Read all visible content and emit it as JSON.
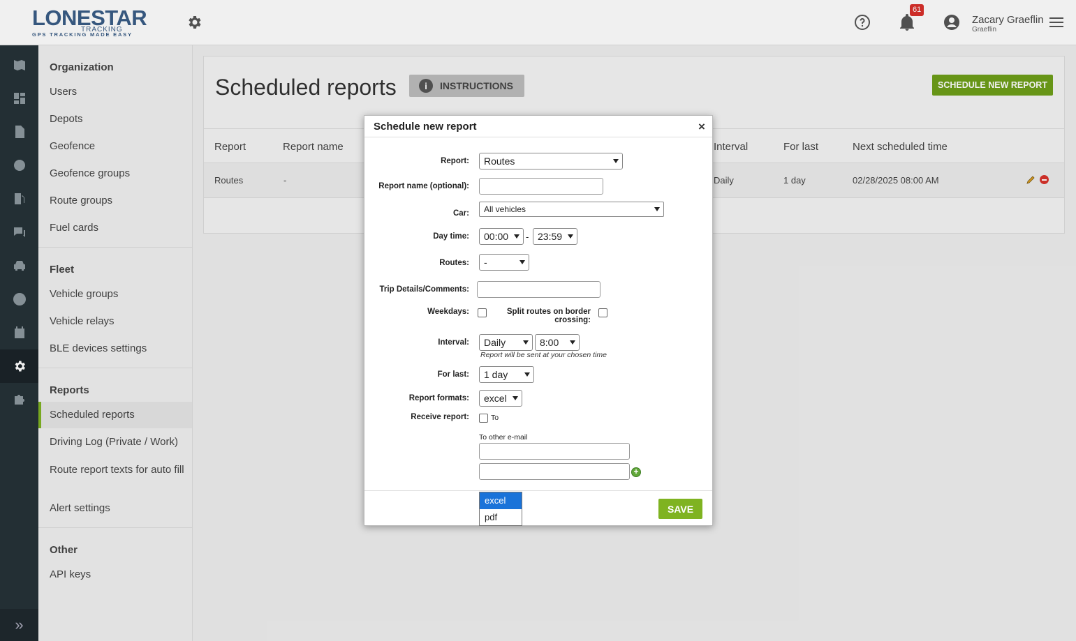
{
  "header": {
    "logo_main": "LONESTAR",
    "logo_sub": "TRACKING",
    "logo_tagline": "GPS TRACKING MADE EASY",
    "notification_count": "61",
    "user_name": "Zacary Graeflin",
    "user_org": "Graeflin"
  },
  "sidebar": {
    "sections": [
      {
        "title": "Organization",
        "items": [
          "Users",
          "Depots",
          "Geofence",
          "Geofence groups",
          "Route groups",
          "Fuel cards"
        ]
      },
      {
        "title": "Fleet",
        "items": [
          "Vehicle groups",
          "Vehicle relays",
          "BLE devices settings"
        ]
      },
      {
        "title": "Reports",
        "items": [
          "Scheduled reports",
          "Driving Log (Private / Work)",
          "Route report texts for auto fill",
          "Alert settings"
        ]
      },
      {
        "title": "Other",
        "items": [
          "API keys"
        ]
      }
    ],
    "active_item": "Scheduled reports"
  },
  "main": {
    "title": "Scheduled reports",
    "instructions_label": "INSTRUCTIONS",
    "new_report_label": "SCHEDULE NEW REPORT",
    "columns": [
      "Report",
      "Report name",
      "Interval",
      "For last",
      "Next scheduled time"
    ],
    "rows": [
      {
        "report": "Routes",
        "name": "-",
        "interval": "Daily",
        "for_last": "1 day",
        "next": "02/28/2025 08:00 AM"
      }
    ]
  },
  "modal": {
    "title": "Schedule new report",
    "close": "×",
    "report_label": "Report:",
    "report_value": "Routes",
    "report_name_label": "Report name (optional):",
    "report_name_value": "",
    "car_label": "Car:",
    "car_value": "All vehicles",
    "daytime_label": "Day time:",
    "daytime_from": "00:00",
    "daytime_sep": "-",
    "daytime_to": "23:59",
    "routes_label": "Routes:",
    "routes_value": "-",
    "trip_label": "Trip Details/Comments:",
    "trip_value": "",
    "weekdays_label": "Weekdays:",
    "split_label": "Split routes on border crossing:",
    "interval_label": "Interval:",
    "interval_value": "Daily",
    "interval_time": "8:00",
    "interval_hint": "Report will be sent at your chosen time",
    "forlast_label": "For last:",
    "forlast_value": "1 day",
    "formats_label": "Report formats:",
    "formats_value": "excel",
    "formats_options": [
      "excel",
      "pdf"
    ],
    "receive_label": "Receive report:",
    "receive_to": "To",
    "other_email_label": "To other e-mail",
    "save_label": "SAVE"
  },
  "colors": {
    "accent_green": "#7fb321",
    "rail_bg": "#263238",
    "brand_blue": "#3a5d86",
    "badge_red": "#d9302b"
  }
}
